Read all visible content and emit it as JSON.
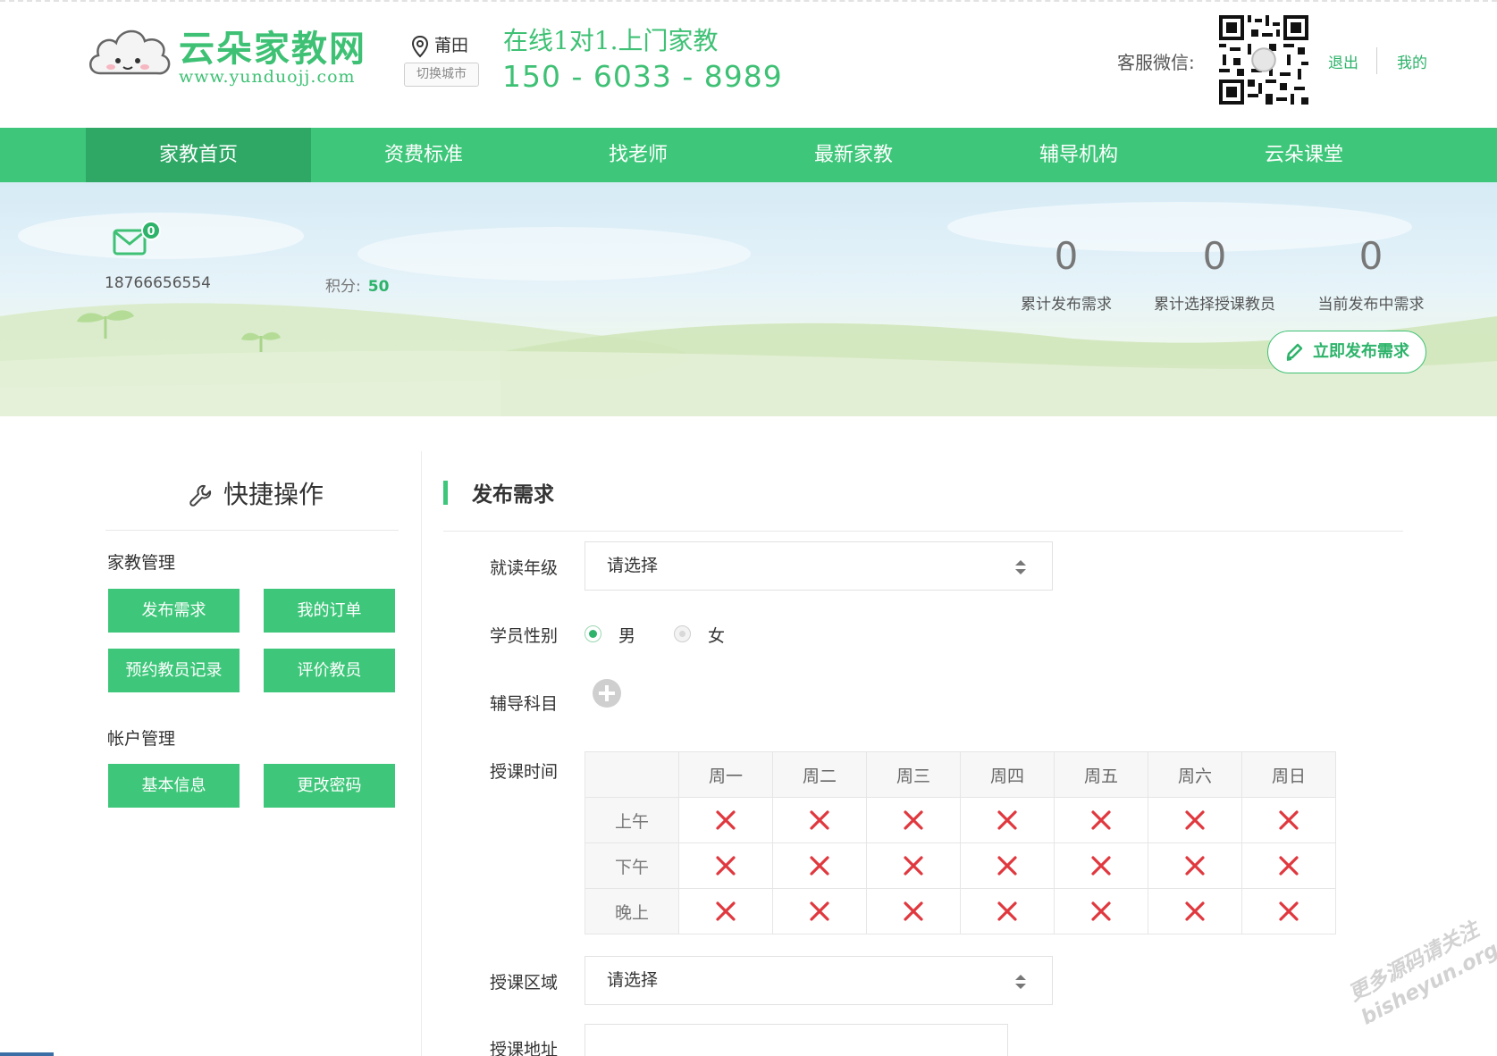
{
  "header": {
    "logo_name": "云朵家教网",
    "logo_url": "www.yunduojj.com",
    "city": "莆田",
    "switch_city": "切换城市",
    "slogan": "在线1对1.上门家教",
    "phone": "150 - 6033 - 8989",
    "wechat_label": "客服微信:",
    "logout": "退出",
    "mine": "我的"
  },
  "nav": {
    "items": [
      "家教首页",
      "资费标准",
      "找老师",
      "最新家教",
      "辅导机构",
      "云朵课堂"
    ],
    "active_index": 0
  },
  "banner": {
    "mail_count": "0",
    "user_phone": "18766656554",
    "points_label": "积分:",
    "points_value": "50",
    "stats": [
      {
        "value": "0",
        "label": "累计发布需求"
      },
      {
        "value": "0",
        "label": "累计选择授课教员"
      },
      {
        "value": "0",
        "label": "当前发布中需求"
      }
    ],
    "publish_button": "立即发布需求"
  },
  "sidebar": {
    "title": "快捷操作",
    "group1": "家教管理",
    "group1_buttons": [
      "发布需求",
      "我的订单",
      "预约教员记录",
      "评价教员"
    ],
    "group2": "帐户管理",
    "group2_buttons": [
      "基本信息",
      "更改密码"
    ]
  },
  "form": {
    "title": "发布需求",
    "grade_label": "就读年级",
    "grade_value": "请选择",
    "gender_label": "学员性别",
    "gender_options": [
      "男",
      "女"
    ],
    "gender_selected": "男",
    "subject_label": "辅导科目",
    "time_label": "授课时间",
    "days": [
      "周一",
      "周二",
      "周三",
      "周四",
      "周五",
      "周六",
      "周日"
    ],
    "periods": [
      "上午",
      "下午",
      "晚上"
    ],
    "area_label": "授课区域",
    "area_value": "请选择",
    "address_label": "授课地址"
  },
  "watermark": {
    "line1": "更多源码请关注",
    "line2": "bisheyun.org"
  },
  "colors": {
    "brand_green": "#3ec77a",
    "nav_active": "#2fa866",
    "unavailable_x": "#e0383e"
  }
}
